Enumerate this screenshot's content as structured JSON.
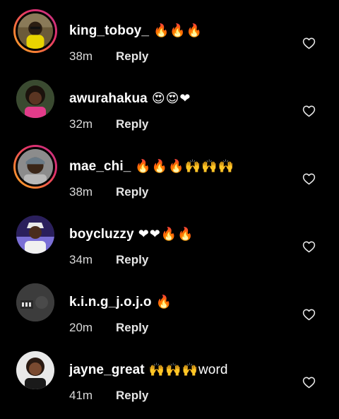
{
  "comments": [
    {
      "username": "king_toboy_",
      "emoji": "🔥🔥🔥",
      "tail": "",
      "time": "38m",
      "reply": "Reply",
      "story_ring": true,
      "avatar_icon": "profile-photo"
    },
    {
      "username": "awurahakua",
      "emoji": "😍😍❤",
      "tail": "",
      "time": "32m",
      "reply": "Reply",
      "story_ring": false,
      "avatar_icon": "profile-photo"
    },
    {
      "username": "mae_chi_",
      "emoji": "🔥🔥🔥🙌🙌🙌",
      "tail": "",
      "time": "38m",
      "reply": "Reply",
      "story_ring": true,
      "avatar_icon": "profile-photo"
    },
    {
      "username": "boycluzzy",
      "emoji": "❤❤🔥🔥",
      "tail": "",
      "time": "34m",
      "reply": "Reply",
      "story_ring": false,
      "avatar_icon": "profile-photo"
    },
    {
      "username": "k.i.n.g_j.o.j.o",
      "emoji": "🔥",
      "tail": "",
      "time": "20m",
      "reply": "Reply",
      "story_ring": false,
      "avatar_icon": "profile-photo"
    },
    {
      "username": "jayne_great",
      "emoji": "🙌🙌🙌",
      "tail": "word",
      "time": "41m",
      "reply": "Reply",
      "story_ring": false,
      "avatar_icon": "profile-photo"
    }
  ],
  "like_icon": "heart-outline-icon",
  "colors": {
    "background": "#000000",
    "text": "#ffffff",
    "meta_text": "#d9d9d9",
    "story_ring_start": "#fbad2b",
    "story_ring_end": "#c13584"
  }
}
